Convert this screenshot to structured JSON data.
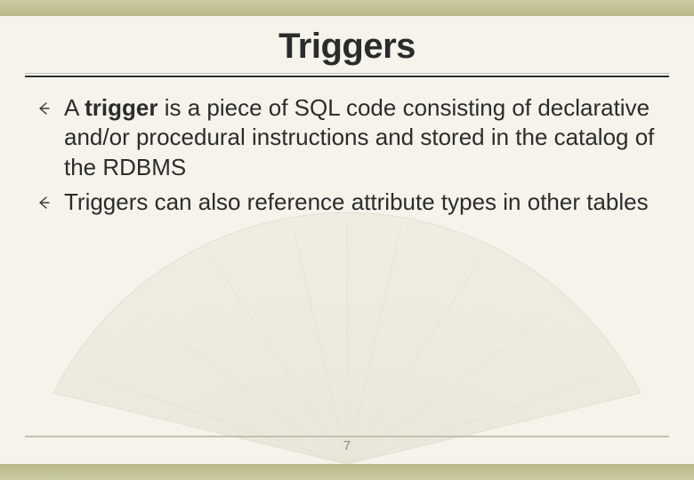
{
  "title": "Triggers",
  "bullets": [
    {
      "prefix": "A ",
      "strong": "trigger",
      "rest": " is a piece of SQL code consisting of declarative and/or procedural instructions and stored in the catalog of the RDBMS"
    },
    {
      "prefix": "",
      "strong": "",
      "rest": "Triggers can also reference attribute types in other tables"
    }
  ],
  "page_number": "7",
  "icons": {
    "bullet_arrow": "left-arrow-icon"
  }
}
